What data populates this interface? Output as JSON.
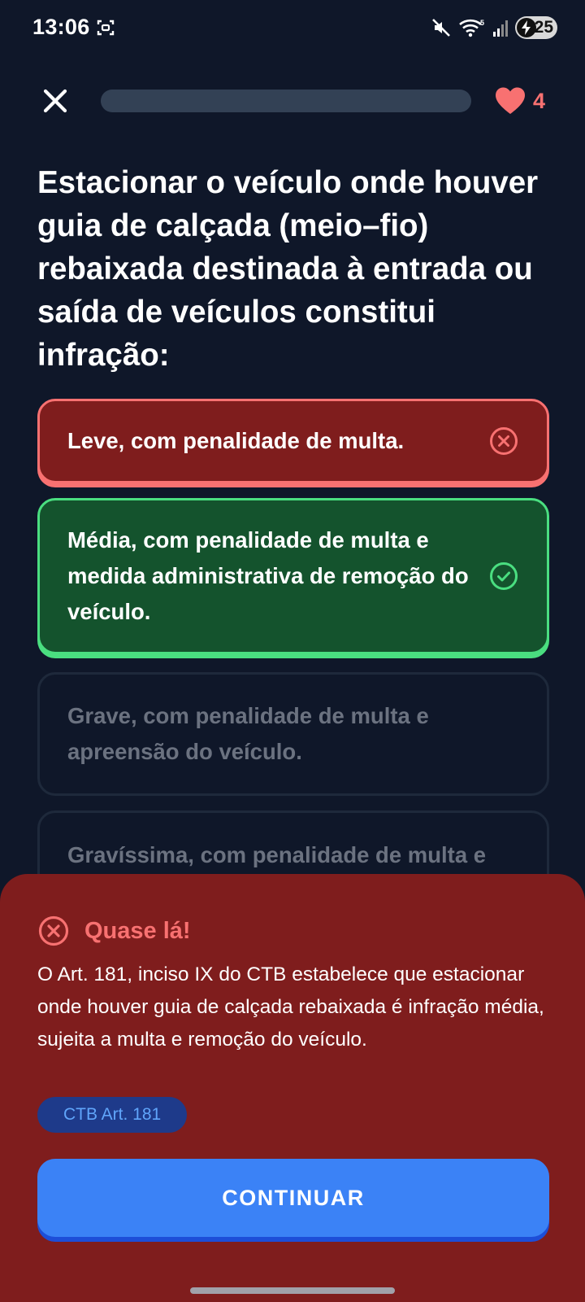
{
  "status_bar": {
    "time": "13:06",
    "battery": "25",
    "icons": [
      "screenshot-icon",
      "mute-icon",
      "wifi-icon",
      "signal-icon",
      "battery-charging-icon"
    ]
  },
  "header": {
    "close_icon": "close-icon",
    "progress": 0,
    "lives": "4",
    "lives_icon": "heart-icon"
  },
  "question": {
    "text": "Estacionar o veículo onde houver guia de calçada (meio–fio) rebaixada destinada à entrada ou saída de veículos constitui infração:"
  },
  "options": [
    {
      "label": "Leve, com penalidade de multa.",
      "state": "wrong",
      "icon": "x-circle-icon"
    },
    {
      "label": "Média, com penalidade de multa e medida administrativa de remoção do veículo.",
      "state": "correct",
      "icon": "check-circle-icon"
    },
    {
      "label": "Grave, com penalidade de multa e apreensão do veículo.",
      "state": "neutral"
    },
    {
      "label": "Gravíssima, com penalidade de multa e",
      "state": "neutral"
    }
  ],
  "feedback": {
    "title": "Quase lá!",
    "icon": "x-circle-icon",
    "text": "O Art. 181, inciso IX do CTB estabelece que estacionar onde houver guia de calçada rebaixada é infração média, sujeita a multa e remoção do veículo.",
    "reference": "CTB Art. 181",
    "continue_label": "CONTINUAR"
  },
  "colors": {
    "background": "#0f1729",
    "wrong": "#7f1d1d",
    "wrong_accent": "#f87171",
    "correct": "#14532d",
    "correct_accent": "#4ade80",
    "primary": "#3b82f6",
    "progress_track": "#334155"
  }
}
